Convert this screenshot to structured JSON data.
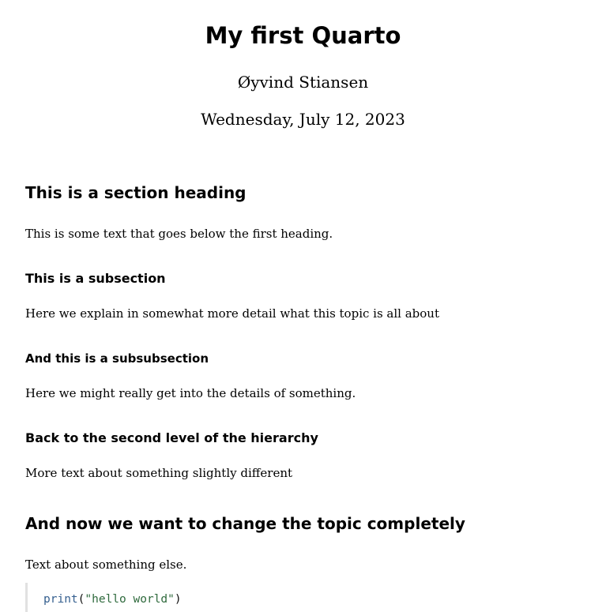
{
  "document": {
    "title": "My first Quarto",
    "author": "Øyvind Stiansen",
    "date": "Wednesday, July 12, 2023"
  },
  "sections": {
    "s1": {
      "heading": "This is a section heading",
      "text": "This is some text that goes below the first heading."
    },
    "s1_1": {
      "heading": "This is a subsection",
      "text": "Here we explain in somewhat more detail what this topic is all about"
    },
    "s1_1_1": {
      "heading": "And this is a subsubsection",
      "text": "Here we might really get into the details of something."
    },
    "s1_2": {
      "heading": "Back to the second level of the hierarchy",
      "text": "More text about something slightly different"
    },
    "s2": {
      "heading": "And now we want to change the topic completely",
      "text": "Text about something else."
    }
  },
  "code": {
    "function": "print",
    "open_paren": "(",
    "string": "\"hello world\"",
    "close_paren": ")",
    "colors": {
      "function": "#355f8f",
      "string": "#2f6a3d",
      "border": "#e1e1e1"
    }
  }
}
